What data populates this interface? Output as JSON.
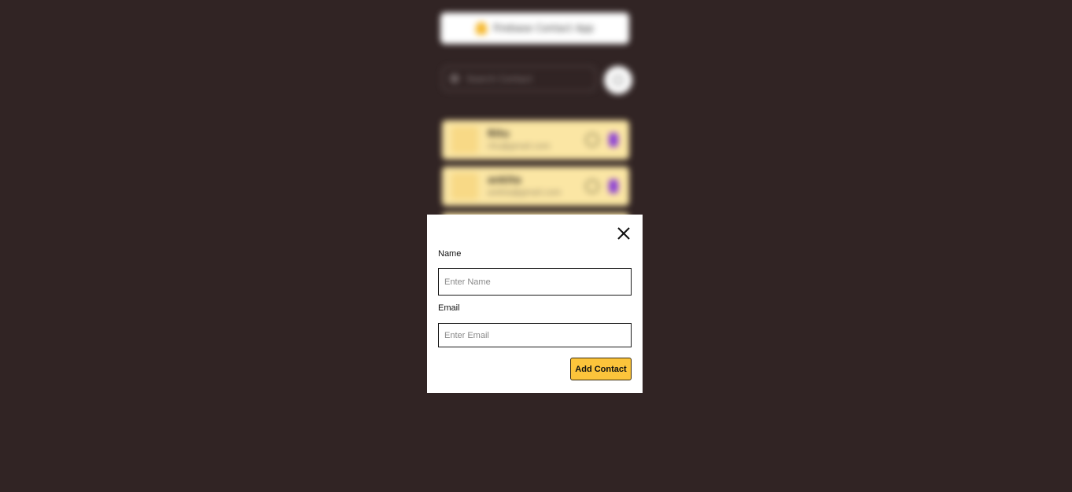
{
  "background_app": {
    "title": "Firebase Contact App",
    "search": {
      "placeholder": "Search Contact"
    },
    "contacts": [
      {
        "name": "Ritu",
        "email": "ritu@gmail.com"
      },
      {
        "name": "ankita",
        "email": "ankita@gmail.com"
      }
    ]
  },
  "modal": {
    "name_label": "Name",
    "name_placeholder": "Enter Name",
    "name_value": "",
    "email_label": "Email",
    "email_placeholder": "Enter Email",
    "email_value": "",
    "submit_label": "Add Contact"
  },
  "colors": {
    "page_background": "#312424",
    "accent": "#fcc43b",
    "contact_card": "#fbe6a4",
    "delete_icon": "#8b3fd6"
  },
  "icons": {
    "close": "close-icon",
    "search": "search-icon",
    "add": "add-icon",
    "header": "fire-icon"
  }
}
